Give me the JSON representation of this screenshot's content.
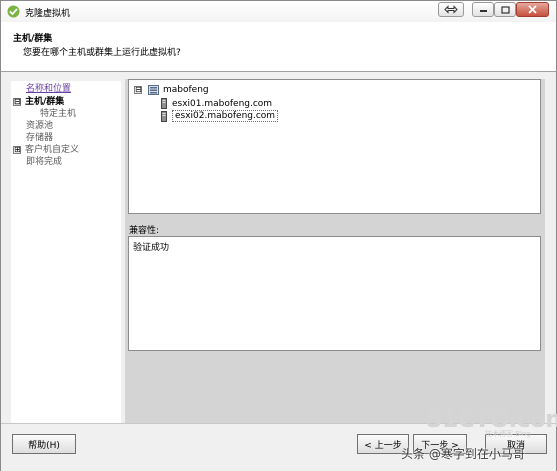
{
  "window": {
    "title": "克隆虚拟机"
  },
  "header": {
    "title": "主机/群集",
    "subtitle": "您要在哪个主机或群集上运行此虚拟机?"
  },
  "sidebar": {
    "items": [
      {
        "label": "名称和位置",
        "state": "link"
      },
      {
        "label": "主机/群集",
        "state": "current",
        "toggle": "⊟"
      },
      {
        "label": "特定主机",
        "state": "child"
      },
      {
        "label": "资源池",
        "state": "pending"
      },
      {
        "label": "存储器",
        "state": "pending"
      },
      {
        "label": "客户机自定义",
        "state": "pending",
        "toggle": "⊞"
      },
      {
        "label": "即将完成",
        "state": "pending"
      }
    ]
  },
  "tree": {
    "root": {
      "label": "mabofeng",
      "toggle": "⊟"
    },
    "hosts": [
      {
        "label": "esxi01.mabofeng.com",
        "selected": false
      },
      {
        "label": "esxi02.mabofeng.com",
        "selected": true
      }
    ]
  },
  "compatibility": {
    "label": "兼容性:",
    "message": "验证成功"
  },
  "footer": {
    "help": "帮助(H)",
    "back": "< 上一步",
    "next": "下一步 >",
    "cancel": "取消"
  },
  "watermarks": {
    "site": "51CTO.com",
    "site_sub": "技术博客 Blog",
    "author": "头条 @寒字到在小马哥"
  }
}
